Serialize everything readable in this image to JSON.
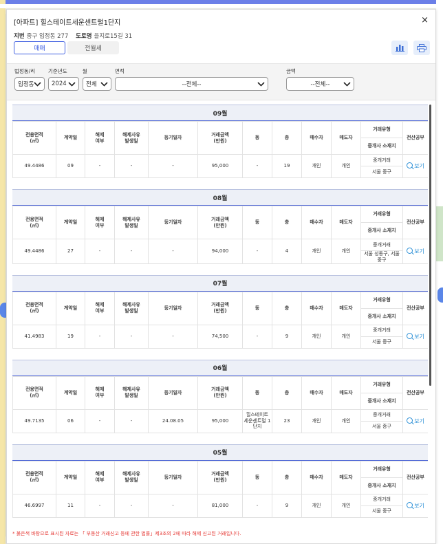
{
  "header": {
    "title": "[아파트] 힐스테이트세운센트럴1단지",
    "jibun_label": "지번",
    "jibun_value": "중구 입정동 277",
    "road_label": "도로명",
    "road_value": "을지로15길 31",
    "close_glyph": "×"
  },
  "tabs": [
    {
      "label": "매매",
      "active": true
    },
    {
      "label": "전월세",
      "active": false
    }
  ],
  "toolbar": {
    "chart_icon": "bar-chart-icon",
    "print_icon": "printer-icon"
  },
  "filters": {
    "dong": {
      "label": "법정동/리",
      "value": "입정동"
    },
    "year": {
      "label": "기준년도",
      "value": "2024"
    },
    "month": {
      "label": "월",
      "value": "전체"
    },
    "area": {
      "label": "면적",
      "value": "--전체--"
    },
    "amount": {
      "label": "금액",
      "value": "--전체--"
    }
  },
  "columns": {
    "area": "전용면적\n(㎡)",
    "contract_day": "계약일",
    "cancel": "해제\n여부",
    "cancel_date": "해제사유\n발생일",
    "reg_date": "등기일자",
    "price": "거래금액\n(만원)",
    "building": "동",
    "floor": "층",
    "buyer": "매수자",
    "seller": "매도자",
    "deal_type": "거래유형",
    "agent_loc": "중개사 소재지",
    "registry": "전산공부"
  },
  "view_label": "보기",
  "months": [
    {
      "month": "09월",
      "area": "49.4486",
      "day": "09",
      "cancel": "-",
      "cancel_date": "-",
      "reg_date": "-",
      "price": "95,000",
      "building": "-",
      "floor": "19",
      "buyer": "개인",
      "seller": "개인",
      "deal_type": "중개거래",
      "agent_loc": "서울 중구"
    },
    {
      "month": "08월",
      "area": "49.4486",
      "day": "27",
      "cancel": "-",
      "cancel_date": "-",
      "reg_date": "-",
      "price": "94,000",
      "building": "-",
      "floor": "4",
      "buyer": "개인",
      "seller": "개인",
      "deal_type": "중개거래",
      "agent_loc": "서울 성동구, 서울 중구"
    },
    {
      "month": "07월",
      "area": "41.4983",
      "day": "19",
      "cancel": "-",
      "cancel_date": "-",
      "reg_date": "-",
      "price": "74,500",
      "building": "-",
      "floor": "9",
      "buyer": "개인",
      "seller": "개인",
      "deal_type": "중개거래",
      "agent_loc": "서울 중구"
    },
    {
      "month": "06월",
      "area": "49.7135",
      "day": "06",
      "cancel": "-",
      "cancel_date": "-",
      "reg_date": "24.08.05",
      "price": "95,000",
      "building": "힐스테이트 세운센트럴 1단지",
      "floor": "23",
      "buyer": "개인",
      "seller": "개인",
      "deal_type": "중개거래",
      "agent_loc": "서울 중구"
    },
    {
      "month": "05월",
      "area": "46.6997",
      "day": "11",
      "cancel": "-",
      "cancel_date": "-",
      "reg_date": "-",
      "price": "81,000",
      "building": "-",
      "floor": "9",
      "buyer": "개인",
      "seller": "개인",
      "deal_type": "중개거래",
      "agent_loc": "서울 중구"
    }
  ],
  "footer": "* 붉은색 바탕으로 표시된 자료는 「 부동산 거래신고 등에 관한 법률」제3조의 2에 따라 해제 신고된 거래입니다.",
  "colors": {
    "accent": "#3d5de0",
    "link": "#2a8fd6",
    "warning": "#e53935"
  }
}
